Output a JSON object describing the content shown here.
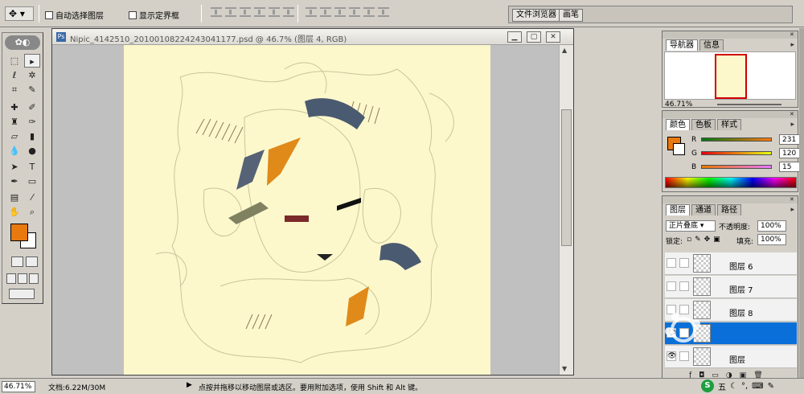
{
  "options_bar": {
    "tool_icon": "move-tool-icon",
    "auto_select_label": "自动选择图层",
    "show_bounds_label": "显示定界框",
    "palette_well": {
      "tabs": [
        "文件浏览器",
        "画笔"
      ]
    }
  },
  "document": {
    "title": "Nipic_4142510_20100108224243041177.psd @ 46.7% (图层 4, RGB)"
  },
  "navigator": {
    "tabs": [
      "导航器",
      "信息"
    ],
    "zoom": "46.71%"
  },
  "color_panel": {
    "tabs": [
      "颜色",
      "色板",
      "样式"
    ],
    "channels": [
      {
        "label": "R",
        "value": "231",
        "fraction": 0.906
      },
      {
        "label": "G",
        "value": "120",
        "fraction": 0.471
      },
      {
        "label": "B",
        "value": "15",
        "fraction": 0.059
      }
    ],
    "foreground": "#e7780f",
    "background": "#ffffff"
  },
  "layers_panel": {
    "tabs": [
      "图层",
      "通道",
      "路径"
    ],
    "blend_mode": "正片叠底",
    "opacity_label": "不透明度:",
    "opacity_value": "100%",
    "lock_label": "锁定:",
    "fill_label": "填充:",
    "fill_value": "100%",
    "layers": [
      {
        "name": "图层 6",
        "visible": false,
        "selected": false
      },
      {
        "name": "图层 7",
        "visible": false,
        "selected": false
      },
      {
        "name": "图层 8",
        "visible": false,
        "selected": false
      },
      {
        "name": "",
        "visible": true,
        "selected": true
      },
      {
        "name": "图层",
        "visible": true,
        "selected": false
      }
    ]
  },
  "status_bar": {
    "zoom": "46.71%",
    "doc_info": "文档:6.22M/30M",
    "hint": "点按并拖移以移动图层或选区。要用附加选项，使用 Shift 和 Alt 键。"
  },
  "taskbar": {
    "ime_label": "五"
  },
  "colors": {
    "ui_bg": "#d4d0c8",
    "canvas_bg": "#fcf8cc",
    "layer_selected": "#0a6fd8",
    "foreground": "#e7790f"
  }
}
